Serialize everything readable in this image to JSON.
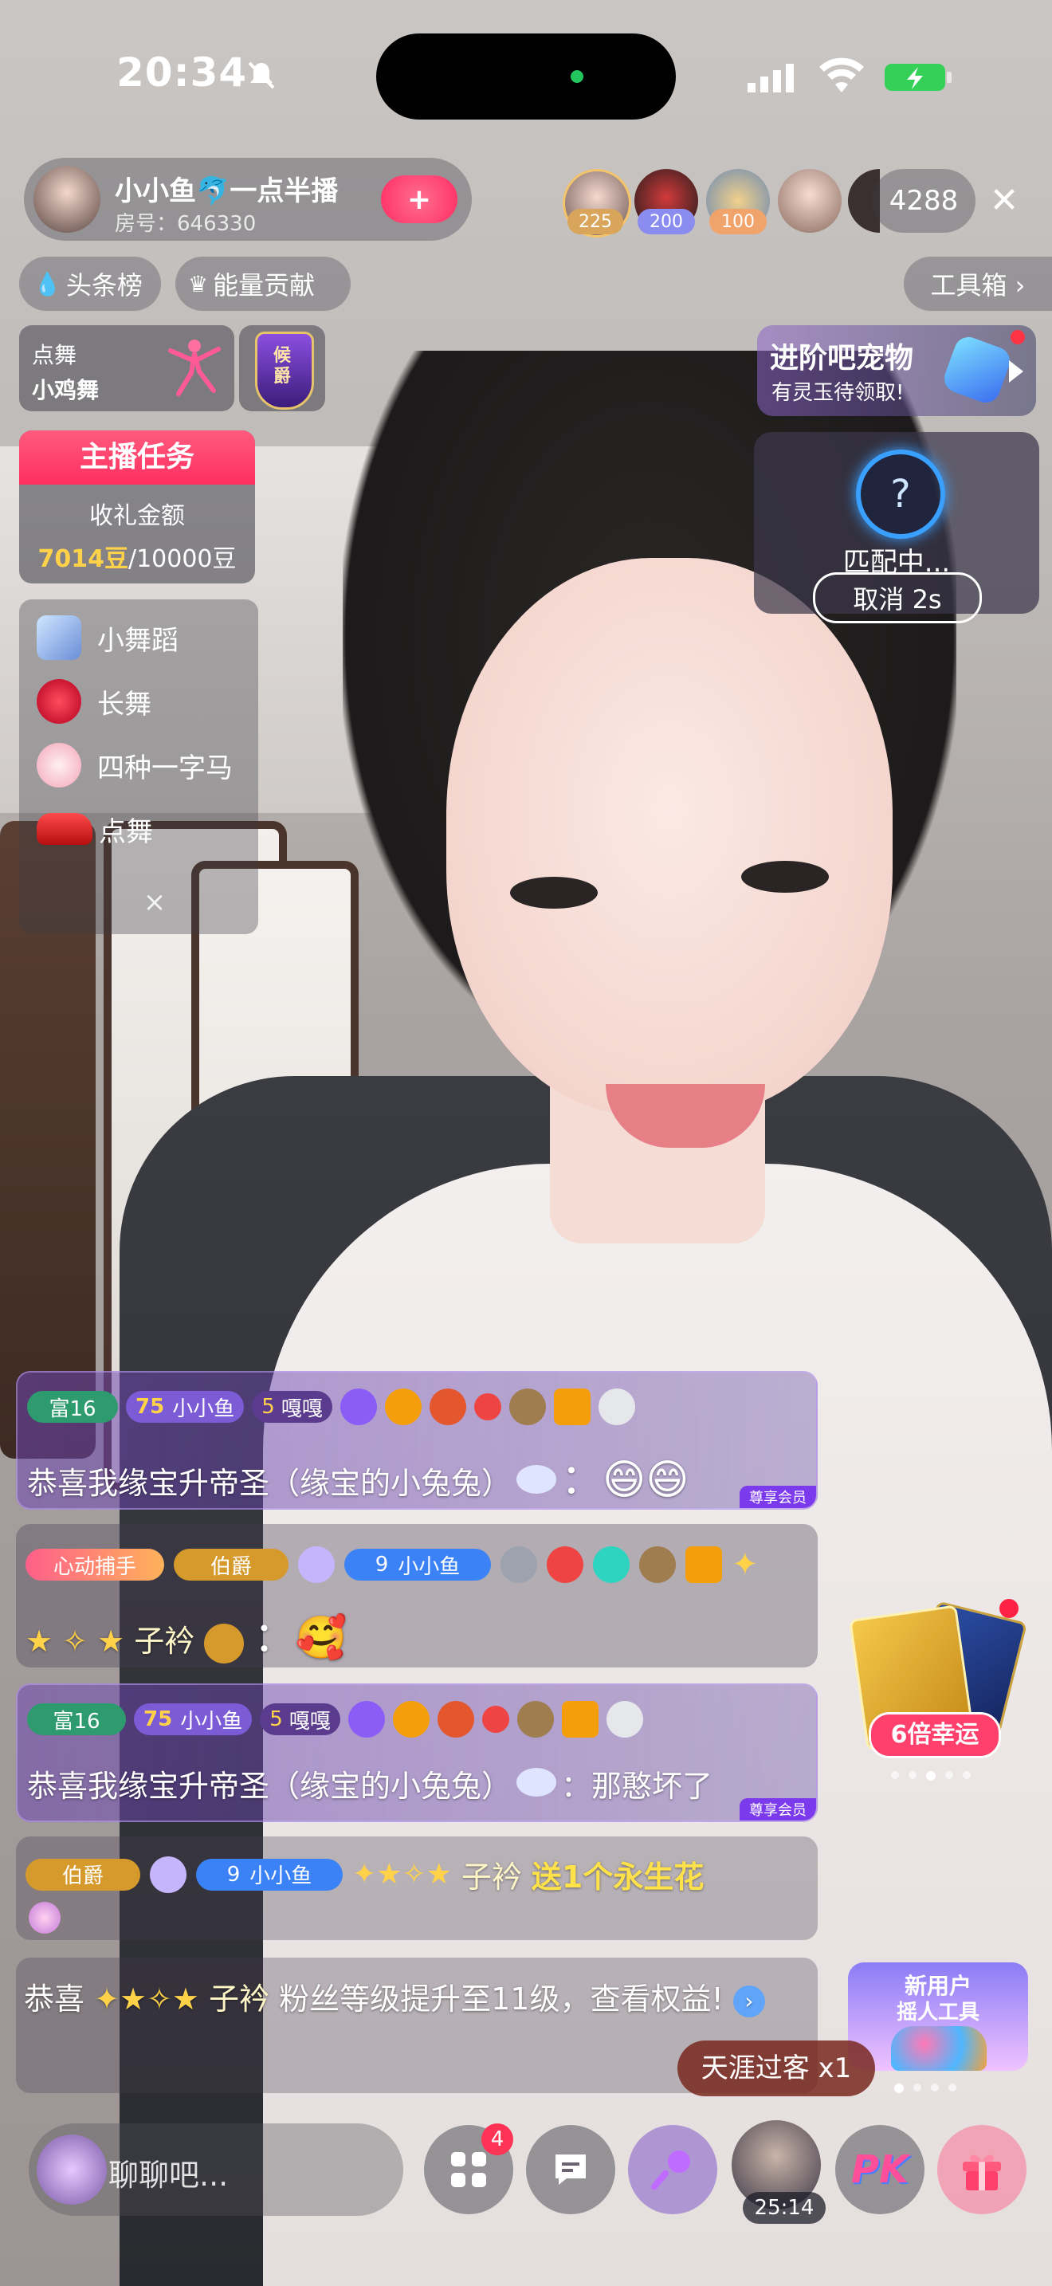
{
  "status_bar": {
    "time": "20:34"
  },
  "host": {
    "name": "小小鱼🐬一点半播",
    "room": "房号：646330",
    "follow_label": "+"
  },
  "viewers": {
    "avatars": [
      {
        "label": "225"
      },
      {
        "label": "200"
      },
      {
        "label": "100"
      },
      {
        "label": ""
      }
    ],
    "count": "4288",
    "close": "✕"
  },
  "chips": {
    "headline": "头条榜",
    "energy": "能量贡献",
    "toolbox": "工具箱 ›"
  },
  "dance_card": {
    "line1": "点舞",
    "line2": "小鸡舞"
  },
  "rank_badge": "候爵",
  "task": {
    "title": "主播任务",
    "label": "收礼金额",
    "current": "7014豆",
    "target": "/10000豆"
  },
  "pet": {
    "title": "进阶吧宠物",
    "subtitle": "有灵玉待领取!"
  },
  "match": {
    "status": "匹配中...",
    "cancel": "取消 2s",
    "icon": "?"
  },
  "menu": {
    "items": [
      {
        "label": "小舞蹈"
      },
      {
        "label": "长舞"
      },
      {
        "label": "四种一字马"
      },
      {
        "label": "点舞"
      }
    ],
    "close": "×"
  },
  "chat": {
    "msg1": {
      "level": "富16",
      "fan_level": "75",
      "fan_name": "小小鱼",
      "club_level": "5",
      "club_name": "嘎嘎",
      "text": "恭喜我缘宝升帝圣（缘宝的小兔兔）",
      "tail": "：😄😄",
      "vip": "尊享会员"
    },
    "msg2": {
      "tag": "心动捕手",
      "title": "伯爵",
      "fan_level": "9",
      "fan_name": "小小鱼",
      "user": "子衿",
      "tail": "：🥰"
    },
    "msg3": {
      "level": "富16",
      "fan_level": "75",
      "fan_name": "小小鱼",
      "club_level": "5",
      "club_name": "嘎嘎",
      "text": "恭喜我缘宝升帝圣（缘宝的小兔兔）",
      "tail": "：那憨坏了",
      "vip": "尊享会员"
    },
    "msg4": {
      "title": "伯爵",
      "fan_level": "9",
      "fan_name": "小小鱼",
      "user": "子衿",
      "gift": "送1个永生花"
    },
    "msg5": {
      "prefix": "恭喜",
      "user": "子衿",
      "text": "粉丝等级提升至11级，查看权益!"
    }
  },
  "luck": {
    "label": "6倍幸运"
  },
  "newuser": {
    "line1": "新用户",
    "line2": "摇人工具"
  },
  "gift_toast": "天涯过客 x1",
  "bottom": {
    "input_placeholder": "聊聊吧...",
    "apps_badge": "4",
    "timer": "25:14",
    "pk_label": "PK"
  },
  "colors": {
    "accent_pink": "#ff3f6c",
    "gold": "#ffd24a",
    "purple": "#8b5cf6"
  }
}
